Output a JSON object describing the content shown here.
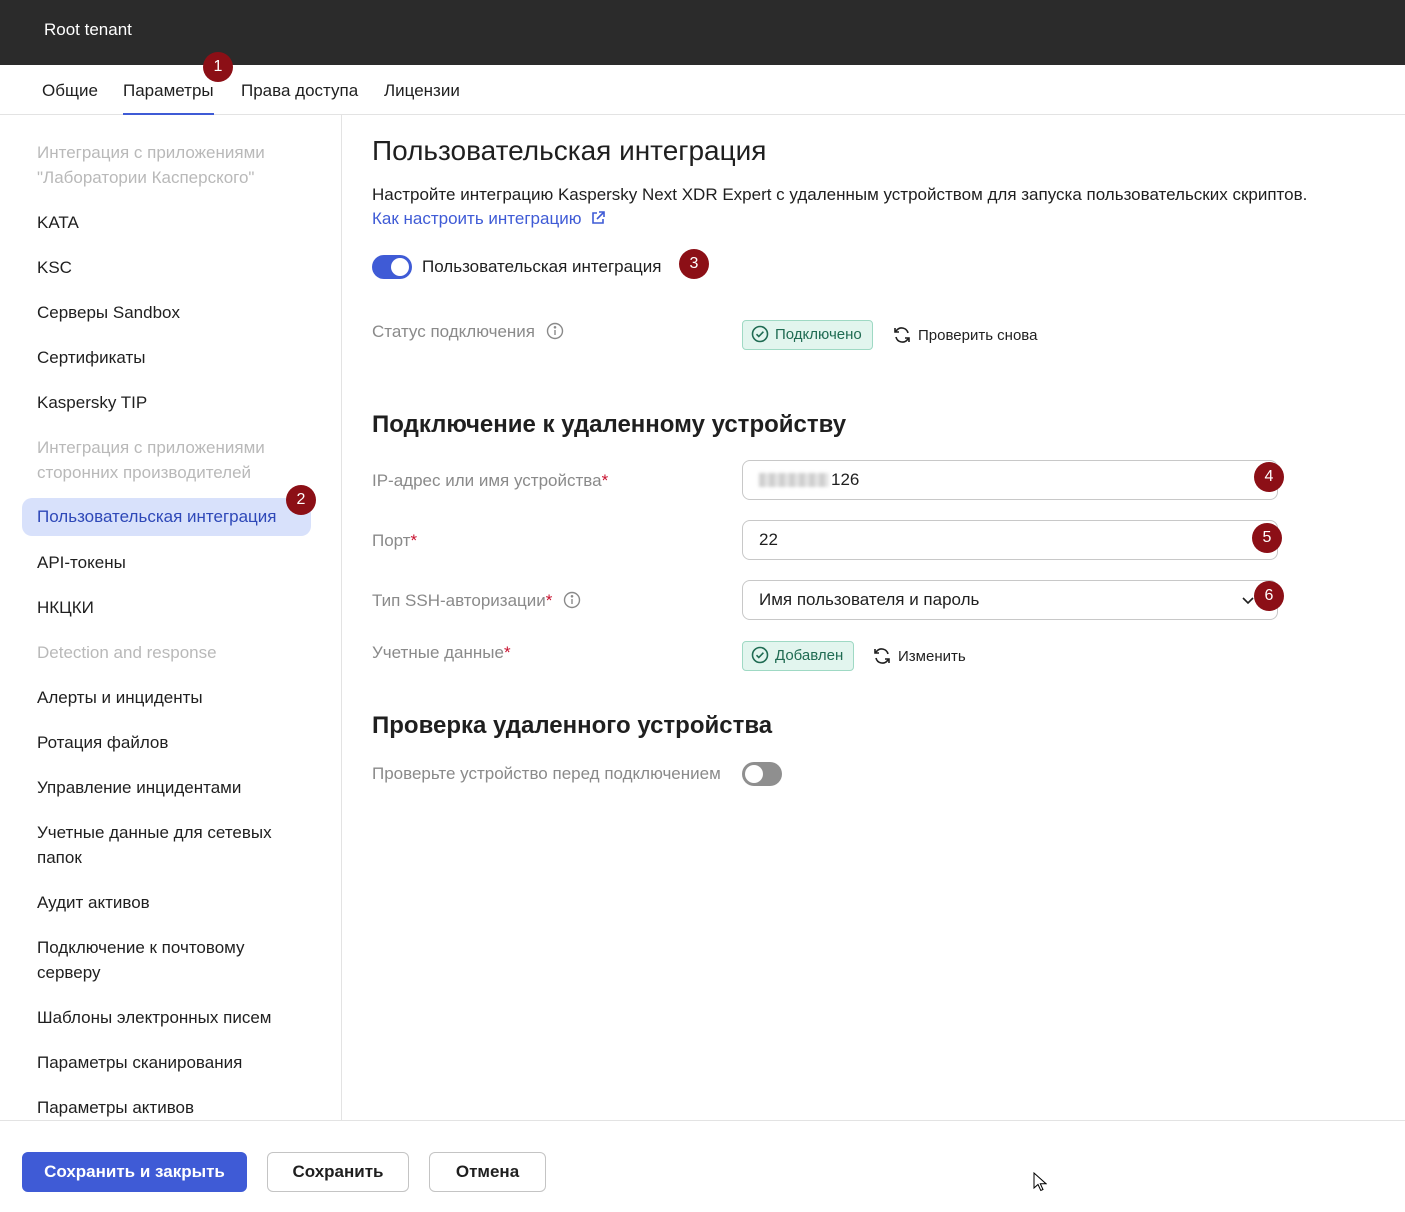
{
  "header": {
    "tenant": "Root tenant"
  },
  "tabs": [
    {
      "label": "Общие",
      "active": false
    },
    {
      "label": "Параметры",
      "active": true
    },
    {
      "label": "Права доступа",
      "active": false
    },
    {
      "label": "Лицензии",
      "active": false
    }
  ],
  "callouts": [
    "1",
    "2",
    "3",
    "4",
    "5",
    "6"
  ],
  "sidebar": {
    "items": [
      {
        "label": "Интеграция с приложениями \"Лаборатории Касперского\"",
        "type": "group"
      },
      {
        "label": "KATA",
        "type": "item"
      },
      {
        "label": "KSC",
        "type": "item"
      },
      {
        "label": "Серверы Sandbox",
        "type": "item"
      },
      {
        "label": "Сертификаты",
        "type": "item"
      },
      {
        "label": "Kaspersky TIP",
        "type": "item"
      },
      {
        "label": "Интеграция с приложениями сторонних производителей",
        "type": "group"
      },
      {
        "label": "Пользовательская интеграция",
        "type": "item",
        "active": true
      },
      {
        "label": "API-токены",
        "type": "item"
      },
      {
        "label": "НКЦКИ",
        "type": "item"
      },
      {
        "label": "Detection and response",
        "type": "group"
      },
      {
        "label": "Алерты и инциденты",
        "type": "item"
      },
      {
        "label": "Ротация файлов",
        "type": "item"
      },
      {
        "label": "Управление инцидентами",
        "type": "item"
      },
      {
        "label": "Учетные данные для сетевых папок",
        "type": "item"
      },
      {
        "label": "Аудит активов",
        "type": "item"
      },
      {
        "label": "Подключение к почтовому серверу",
        "type": "item"
      },
      {
        "label": "Шаблоны электронных писем",
        "type": "item"
      },
      {
        "label": "Параметры сканирования",
        "type": "item"
      },
      {
        "label": "Параметры активов",
        "type": "item"
      }
    ]
  },
  "main": {
    "title": "Пользовательская интеграция",
    "description": "Настройте интеграцию Kaspersky Next XDR Expert с удаленным устройством для запуска пользовательских скриптов.",
    "help_link": "Как настроить интеграцию",
    "integration_toggle": {
      "label": "Пользовательская интеграция",
      "on": true
    },
    "connection_status": {
      "label": "Статус подключения",
      "value": "Подключено",
      "recheck": "Проверить снова"
    },
    "remote_section": {
      "title": "Подключение к удаленному устройству",
      "ip_label": "IP-адрес или имя устройства",
      "ip_value_suffix": "126",
      "port_label": "Порт",
      "port_value": "22",
      "ssh_label": "Тип SSH-авторизации",
      "ssh_value": "Имя пользователя и пароль",
      "credentials_label": "Учетные данные",
      "credentials_status": "Добавлен",
      "credentials_edit": "Изменить",
      "required_mark": "*"
    },
    "check_section": {
      "title": "Проверка удаленного устройства",
      "toggle_label": "Проверьте устройство перед подключением",
      "toggle_on": false
    }
  },
  "footer": {
    "save_close": "Сохранить и закрыть",
    "save": "Сохранить",
    "cancel": "Отмена"
  },
  "colors": {
    "accent": "#3f5bd6",
    "topbar": "#2b2b2b",
    "badge": "#8c0f16",
    "success_bg": "#e2f5ee",
    "success_text": "#1f6b52",
    "required": "#c8102e"
  }
}
